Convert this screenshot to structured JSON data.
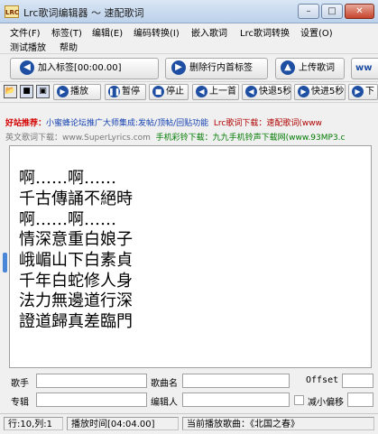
{
  "window": {
    "title": "Lrc歌词编辑器 ～ 速配歌词",
    "icon_label": "LRC"
  },
  "menu": {
    "row1": [
      "文件(F)",
      "标签(T)",
      "编辑(E)",
      "编码转换(I)",
      "嵌入歌词",
      "Lrc歌词转换",
      "设置(O)"
    ],
    "row2": [
      "测试播放",
      "帮助"
    ]
  },
  "toolbar1": {
    "add_tag": "加入标签[00:00.00]",
    "delete_tag": "删除行内首标签",
    "upload": "上传歌词",
    "overflow": "ww"
  },
  "toolbar2": {
    "play": "播放",
    "pause": "暂停",
    "stop": "停止",
    "prev": "上一首",
    "fast_back": "快退5秒",
    "fast_forward": "快进5秒",
    "next": "下"
  },
  "ads": {
    "line1_label": "好站推荐：",
    "line1_link": "小蜜蜂论坛推广大师集成:发帖/顶帖/回贴功能",
    "line1_lrc": "Lrc歌词下载：速配歌词",
    "line1_url": "(www",
    "line2_label": "英文歌词下载：www.SuperLyrics.com",
    "line2_ring": "手机彩铃下载：",
    "line2_site": "九九手机铃声下载网(www.93MP3.c"
  },
  "lyrics": [
    "啊……啊……",
    "千古傳誦不絕時",
    "啊……啊……",
    "情深意重白娘子",
    "峨嵋山下白素貞",
    "千年白蛇修人身",
    "法力無邊道行深",
    "證道歸真差臨門"
  ],
  "fields": {
    "artist_label": "歌手",
    "title_label": "歌曲名",
    "offset_label": "Offset",
    "album_label": "专辑",
    "editor_label": "编辑人",
    "offset_mode_label": "减小偏移"
  },
  "status": {
    "position": "行:10,列:1",
    "play_time": "播放时间[04:04.00]",
    "current_song": "当前播放歌曲：《北国之春》"
  }
}
